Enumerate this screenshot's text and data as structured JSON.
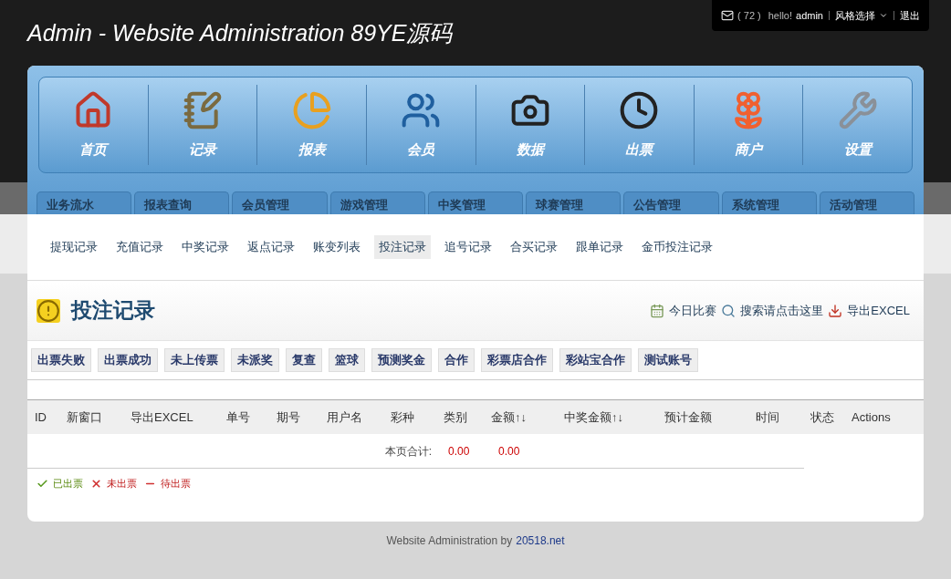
{
  "header": {
    "title": "Admin - Website Administration 89YE源码",
    "message_count": "( 72 )",
    "greeting": "hello!",
    "user": "admin",
    "style_menu": "风格选择",
    "logout": "退出"
  },
  "main_nav": [
    {
      "label": "首页"
    },
    {
      "label": "记录"
    },
    {
      "label": "报表"
    },
    {
      "label": "会员"
    },
    {
      "label": "数据"
    },
    {
      "label": "出票"
    },
    {
      "label": "商户"
    },
    {
      "label": "设置"
    }
  ],
  "tabs": [
    {
      "label": "业务流水",
      "selected": false
    },
    {
      "label": "报表查询",
      "selected": false
    },
    {
      "label": "会员管理",
      "selected": false
    },
    {
      "label": "游戏管理",
      "selected": false
    },
    {
      "label": "中奖管理",
      "selected": false
    },
    {
      "label": "球赛管理",
      "selected": false
    },
    {
      "label": "公告管理",
      "selected": false
    },
    {
      "label": "系统管理",
      "selected": false
    },
    {
      "label": "活动管理",
      "selected": false
    }
  ],
  "sub_nav": [
    {
      "label": "提现记录",
      "selected": false
    },
    {
      "label": "充值记录",
      "selected": false
    },
    {
      "label": "中奖记录",
      "selected": false
    },
    {
      "label": "返点记录",
      "selected": false
    },
    {
      "label": "账变列表",
      "selected": false
    },
    {
      "label": "投注记录",
      "selected": true
    },
    {
      "label": "追号记录",
      "selected": false
    },
    {
      "label": "合买记录",
      "selected": false
    },
    {
      "label": "跟单记录",
      "selected": false
    },
    {
      "label": "金币投注记录",
      "selected": false
    }
  ],
  "page_title": "投注记录",
  "actions": [
    {
      "label": "今日比赛"
    },
    {
      "label": "搜索请点击这里"
    },
    {
      "label": "导出EXCEL"
    }
  ],
  "filters": [
    "出票失败",
    "出票成功",
    "未上传票",
    "未派奖",
    "复查",
    "篮球",
    "预测奖金",
    "合作",
    "彩票店合作",
    "彩站宝合作",
    "测试账号"
  ],
  "table": {
    "columns": [
      "ID",
      "新窗口",
      "导出EXCEL",
      "单号",
      "期号",
      "用户名",
      "彩种",
      "类别",
      "金额↑↓",
      "中奖金额↑↓",
      "预计金额",
      "时间",
      "状态",
      "Actions"
    ],
    "total_label": "本页合计:",
    "total_amount": "0.00",
    "total_prize": "0.00"
  },
  "legend": [
    {
      "kind": "done",
      "label": "已出票"
    },
    {
      "kind": "failed",
      "label": "未出票"
    },
    {
      "kind": "pending",
      "label": "待出票"
    }
  ],
  "footer": {
    "text": "Website Administration by",
    "link": "20518.net"
  }
}
